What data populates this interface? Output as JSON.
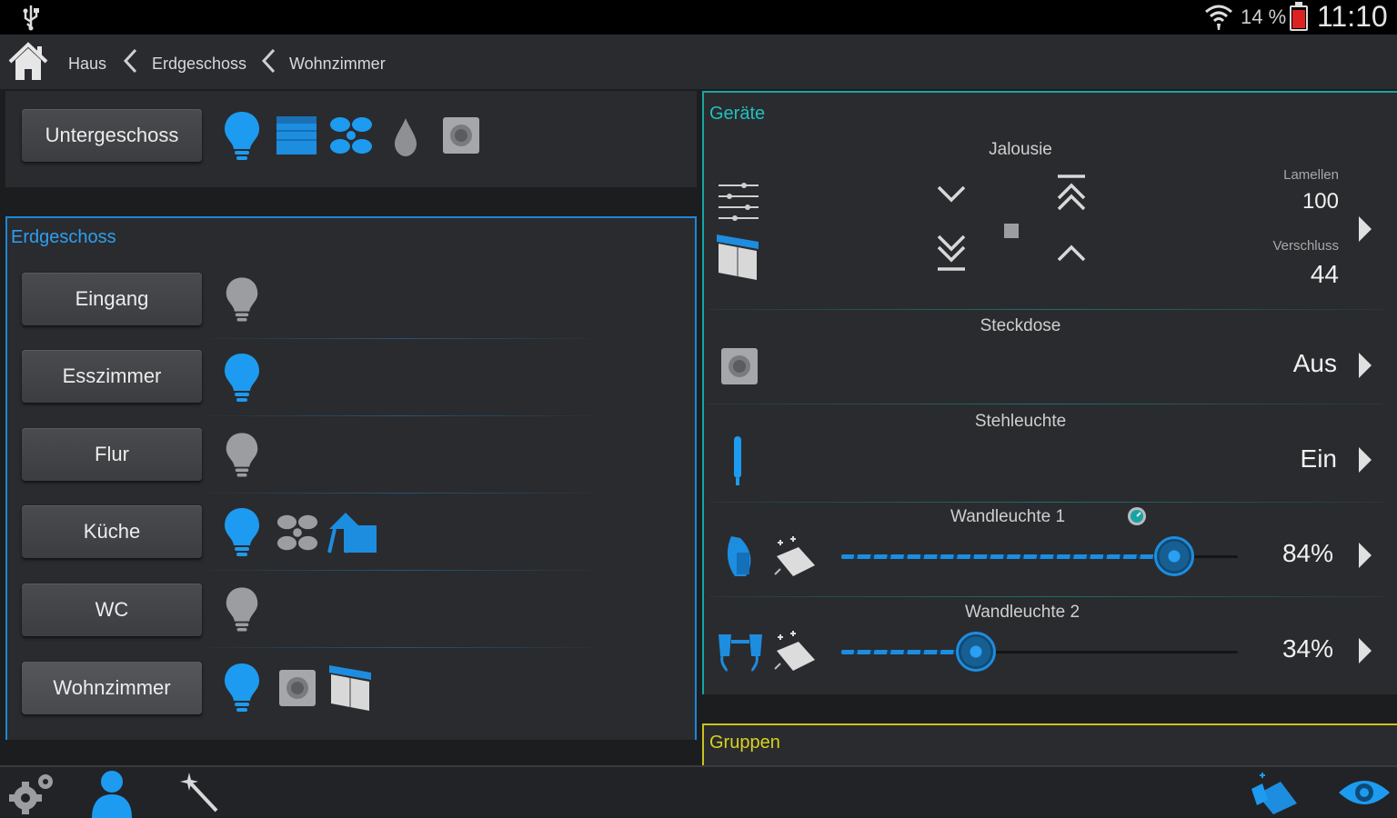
{
  "status_bar": {
    "battery_pct": "14 %",
    "clock": "11:10"
  },
  "breadcrumb": [
    {
      "label": "Haus"
    },
    {
      "label": "Erdgeschoss"
    },
    {
      "label": "Wohnzimmer"
    }
  ],
  "untergeschoss": {
    "label": "Untergeschoss"
  },
  "erdgeschoss": {
    "title": "Erdgeschoss",
    "rooms": [
      {
        "label": "Eingang"
      },
      {
        "label": "Esszimmer"
      },
      {
        "label": "Flur"
      },
      {
        "label": "Küche"
      },
      {
        "label": "WC"
      },
      {
        "label": "Wohnzimmer"
      }
    ]
  },
  "geraete": {
    "title": "Geräte",
    "jalousie": {
      "title": "Jalousie",
      "lamellen_label": "Lamellen",
      "lamellen_value": "100",
      "verschluss_label": "Verschluss",
      "verschluss_value": "44"
    },
    "steckdose": {
      "title": "Steckdose",
      "state": "Aus"
    },
    "stehleuchte": {
      "title": "Stehleuchte",
      "state": "Ein"
    },
    "wandleuchte1": {
      "title": "Wandleuchte 1",
      "value_text": "84%",
      "level": 0.84
    },
    "wandleuchte2": {
      "title": "Wandleuchte 2",
      "value_text": "34%",
      "level": 0.34
    }
  },
  "gruppen": {
    "title": "Gruppen"
  },
  "colors": {
    "accent_blue": "#1d8de0",
    "geraete_teal": "#17a5a5",
    "gruppen_yellow": "#c7c31a"
  }
}
